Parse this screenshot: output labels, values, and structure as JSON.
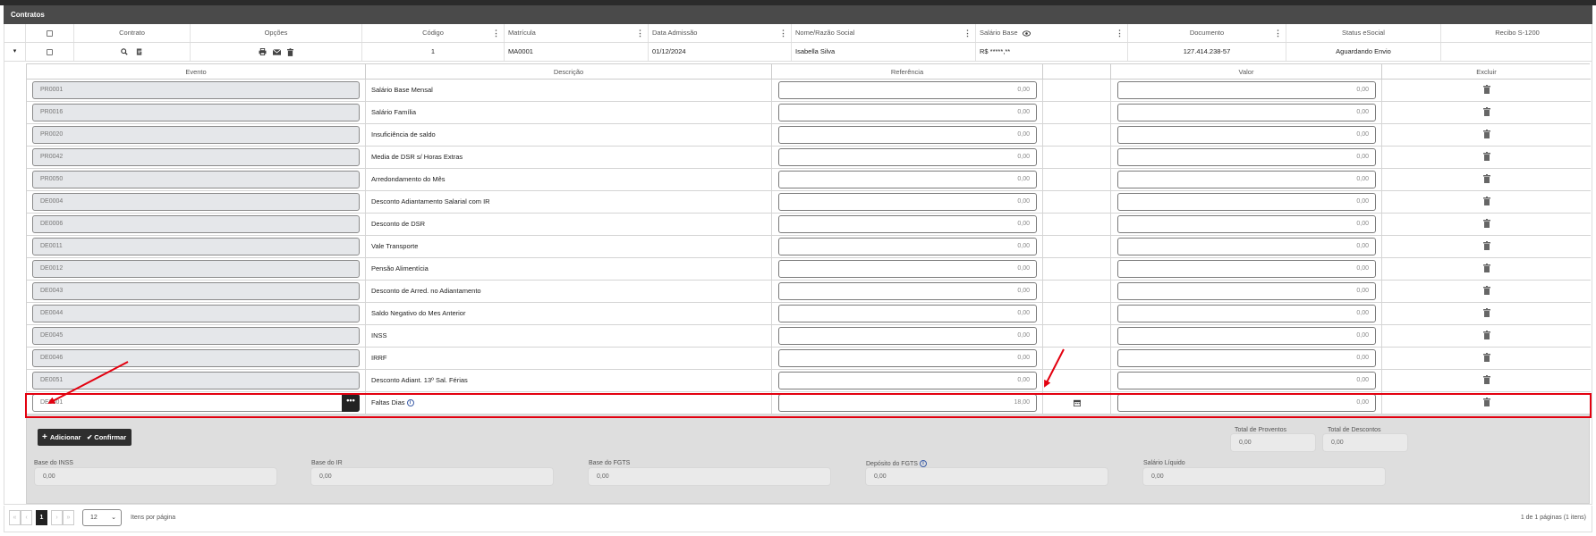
{
  "section_title": "Contratos",
  "grid": {
    "columns": [
      "Contrato",
      "Opções",
      "Código",
      "Matrícula",
      "Data Admissão",
      "Nome/Razão Social",
      "Salário Base",
      "Documento",
      "Status eSocial",
      "Recibo S-1200"
    ],
    "row": {
      "codigo": "1",
      "matricula": "MA0001",
      "data_admissao": "01/12/2024",
      "nome": "Isabella Silva",
      "salario_base": "R$ *****,**",
      "documento": "127.414.238-57",
      "status_esocial": "Aguardando Envio",
      "recibo": ""
    }
  },
  "eventos": {
    "headers": {
      "evento": "Evento",
      "descricao": "Descrição",
      "referencia": "Referência",
      "valor": "Valor",
      "excluir": "Excluir"
    },
    "rows": [
      {
        "code": "PR0001",
        "desc": "Salário Base Mensal",
        "ref": "0,00",
        "valor": "0,00"
      },
      {
        "code": "PR0016",
        "desc": "Salário Família",
        "ref": "0,00",
        "valor": "0,00"
      },
      {
        "code": "PR0020",
        "desc": "Insuficiência de saldo",
        "ref": "0,00",
        "valor": "0,00"
      },
      {
        "code": "PR0042",
        "desc": "Media de DSR s/ Horas Extras",
        "ref": "0,00",
        "valor": "0,00"
      },
      {
        "code": "PR0050",
        "desc": "Arredondamento do Mês",
        "ref": "0,00",
        "valor": "0,00"
      },
      {
        "code": "DE0004",
        "desc": "Desconto Adiantamento Salarial com IR",
        "ref": "0,00",
        "valor": "0,00"
      },
      {
        "code": "DE0006",
        "desc": "Desconto de DSR",
        "ref": "0,00",
        "valor": "0,00"
      },
      {
        "code": "DE0011",
        "desc": "Vale Transporte",
        "ref": "0,00",
        "valor": "0,00"
      },
      {
        "code": "DE0012",
        "desc": "Pensão Alimentícia",
        "ref": "0,00",
        "valor": "0,00"
      },
      {
        "code": "DE0043",
        "desc": "Desconto de Arred. no Adiantamento",
        "ref": "0,00",
        "valor": "0,00"
      },
      {
        "code": "DE0044",
        "desc": "Saldo Negativo do Mes Anterior",
        "ref": "0,00",
        "valor": "0,00"
      },
      {
        "code": "DE0045",
        "desc": "INSS",
        "ref": "0,00",
        "valor": "0,00"
      },
      {
        "code": "DE0046",
        "desc": "IRRF",
        "ref": "0,00",
        "valor": "0,00"
      },
      {
        "code": "DE0051",
        "desc": "Desconto Adiant. 13º Sal. Férias",
        "ref": "0,00",
        "valor": "0,00"
      }
    ],
    "new_row": {
      "code": "DE0001",
      "desc": "Faltas Dias",
      "ref": "18,00",
      "valor": "0,00",
      "dots": "•••"
    }
  },
  "buttons": {
    "adicionar": "Adicionar",
    "confirmar": "Confirmar"
  },
  "totals": {
    "total_proventos_label": "Total de Proventos",
    "total_proventos": "0,00",
    "total_descontos_label": "Total de Descontos",
    "total_descontos": "0,00",
    "base_inss_label": "Base do INSS",
    "base_inss": "0,00",
    "base_ir_label": "Base do IR",
    "base_ir": "0,00",
    "base_fgts_label": "Base do FGTS",
    "base_fgts": "0,00",
    "deposito_fgts_label": "Depósito do FGTS",
    "deposito_fgts": "0,00",
    "salario_liquido_label": "Salário Líquido",
    "salario_liquido": "0,00"
  },
  "pagination": {
    "current_page": "1",
    "per_page": "12",
    "per_page_label": "Itens por página",
    "info": "1 de 1 páginas (1 itens)"
  },
  "colors": {
    "accent_dark": "#2e2e2e",
    "highlight": "#e3000f",
    "panel_bg": "#dedede"
  }
}
